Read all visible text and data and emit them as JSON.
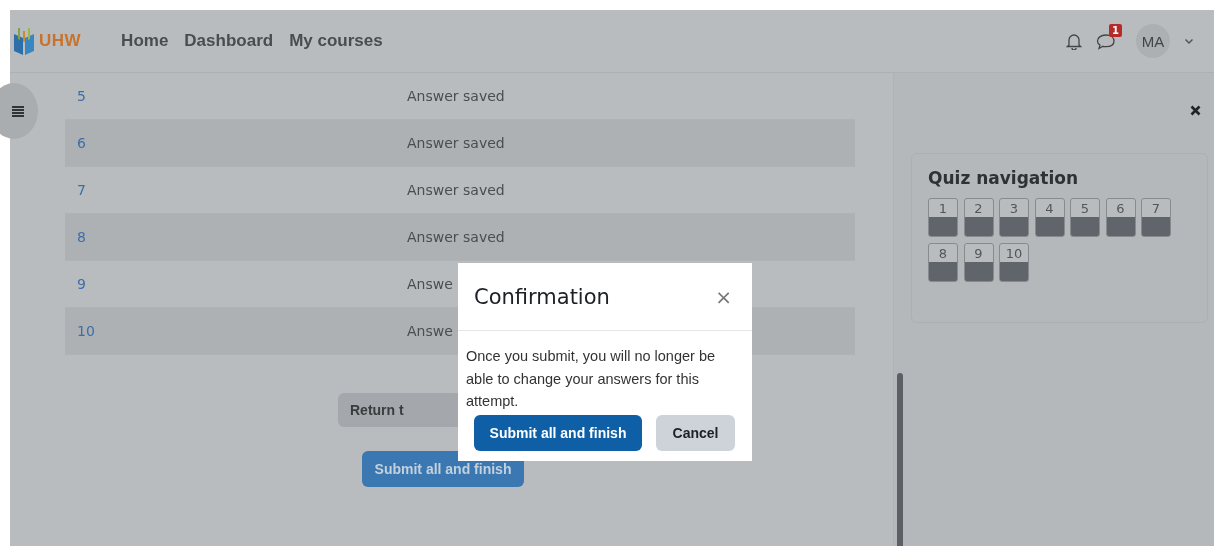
{
  "navbar": {
    "logo_text": "UHW",
    "links": [
      {
        "label": "Home"
      },
      {
        "label": "Dashboard"
      },
      {
        "label": "My courses"
      }
    ],
    "message_badge": "1",
    "avatar": "MA"
  },
  "summary_rows": [
    {
      "question": "5",
      "status": "Answer saved"
    },
    {
      "question": "6",
      "status": "Answer saved"
    },
    {
      "question": "7",
      "status": "Answer saved"
    },
    {
      "question": "8",
      "status": "Answer saved"
    },
    {
      "question": "9",
      "status": "Answe"
    },
    {
      "question": "10",
      "status": "Answe"
    }
  ],
  "return_button": "Return t",
  "submit_button": "Submit all and finish",
  "quiz_navigation": {
    "title": "Quiz navigation",
    "questions": [
      {
        "label": "1",
        "answered": true
      },
      {
        "label": "2",
        "answered": true
      },
      {
        "label": "3",
        "answered": true
      },
      {
        "label": "4",
        "answered": true
      },
      {
        "label": "5",
        "answered": true
      },
      {
        "label": "6",
        "answered": true
      },
      {
        "label": "7",
        "answered": true
      },
      {
        "label": "8",
        "answered": true
      },
      {
        "label": "9",
        "answered": true
      },
      {
        "label": "10",
        "answered": true
      }
    ]
  },
  "modal": {
    "title": "Confirmation",
    "close": "×",
    "body": "Once you submit, you will no longer be able to change your answers for this attempt.",
    "buttons": [
      {
        "label": "Submit all and finish",
        "kind": "primary"
      },
      {
        "label": "Cancel",
        "kind": "secondary"
      }
    ]
  }
}
